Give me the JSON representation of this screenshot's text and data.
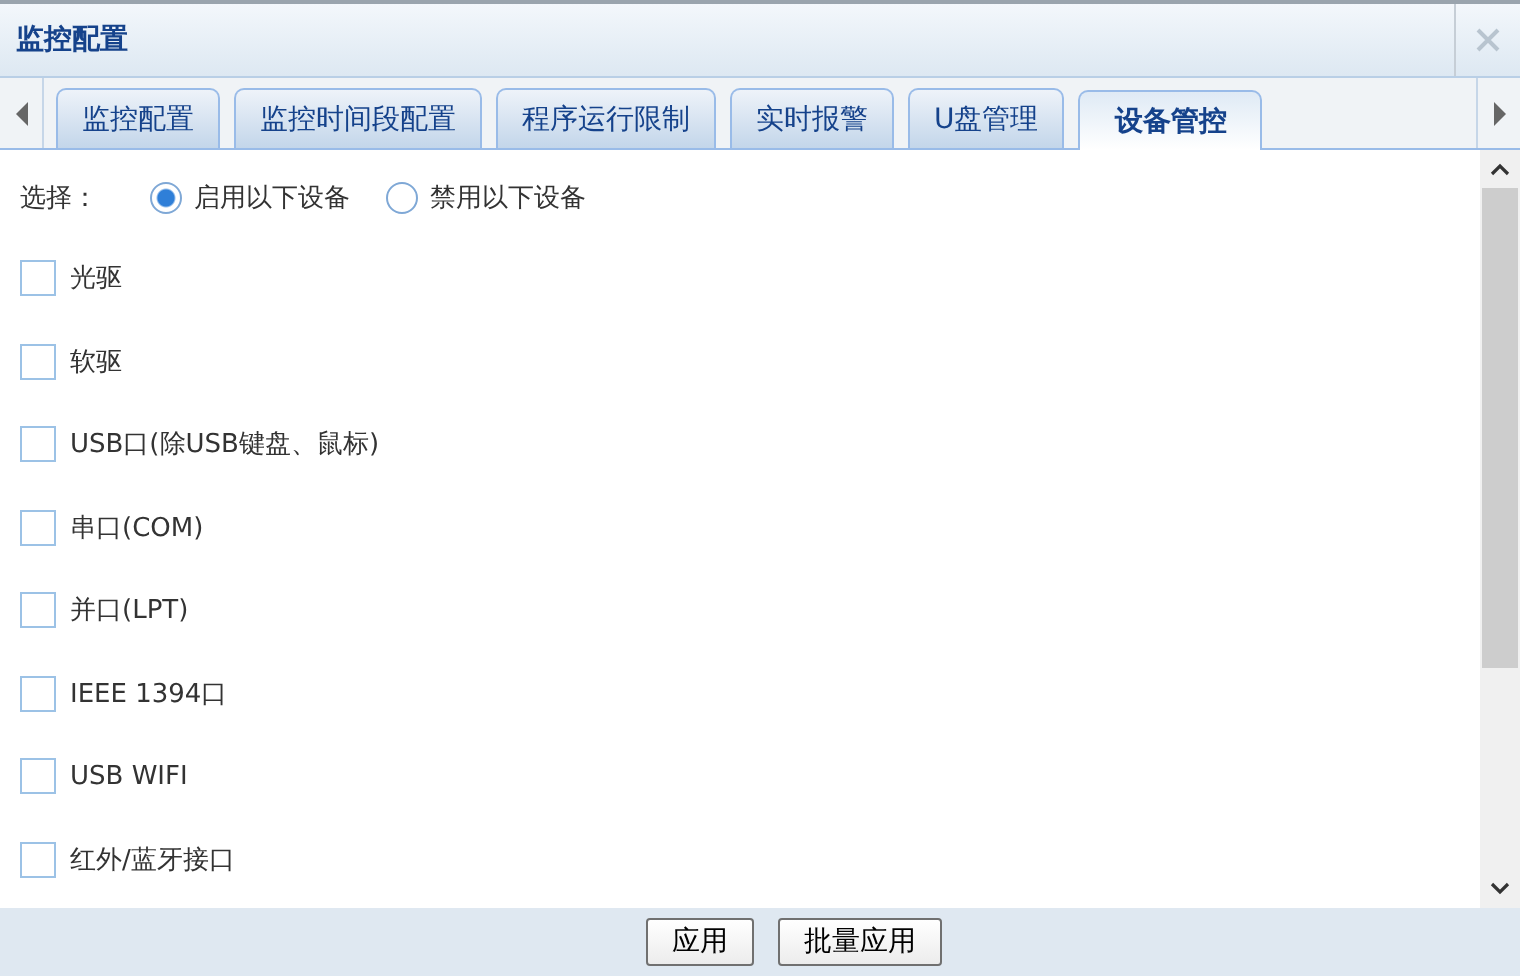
{
  "window": {
    "title": "监控配置"
  },
  "tabs": [
    {
      "label": "监控配置",
      "selected": false
    },
    {
      "label": "监控时间段配置",
      "selected": false
    },
    {
      "label": "程序运行限制",
      "selected": false
    },
    {
      "label": "实时报警",
      "selected": false
    },
    {
      "label": "U盘管理",
      "selected": false
    },
    {
      "label": "设备管控",
      "selected": true
    }
  ],
  "mode": {
    "label": "选择：",
    "options": [
      {
        "label": "启用以下设备",
        "selected": true
      },
      {
        "label": "禁用以下设备",
        "selected": false
      }
    ]
  },
  "devices": [
    {
      "label": "光驱",
      "checked": false
    },
    {
      "label": "软驱",
      "checked": false
    },
    {
      "label": "USB口(除USB键盘、鼠标)",
      "checked": false
    },
    {
      "label": "串口(COM)",
      "checked": false
    },
    {
      "label": "并口(LPT)",
      "checked": false
    },
    {
      "label": "IEEE 1394口",
      "checked": false
    },
    {
      "label": "USB WIFI",
      "checked": false
    },
    {
      "label": "红外/蓝牙接口",
      "checked": false
    }
  ],
  "buttons": [
    "应用",
    "批量应用"
  ]
}
